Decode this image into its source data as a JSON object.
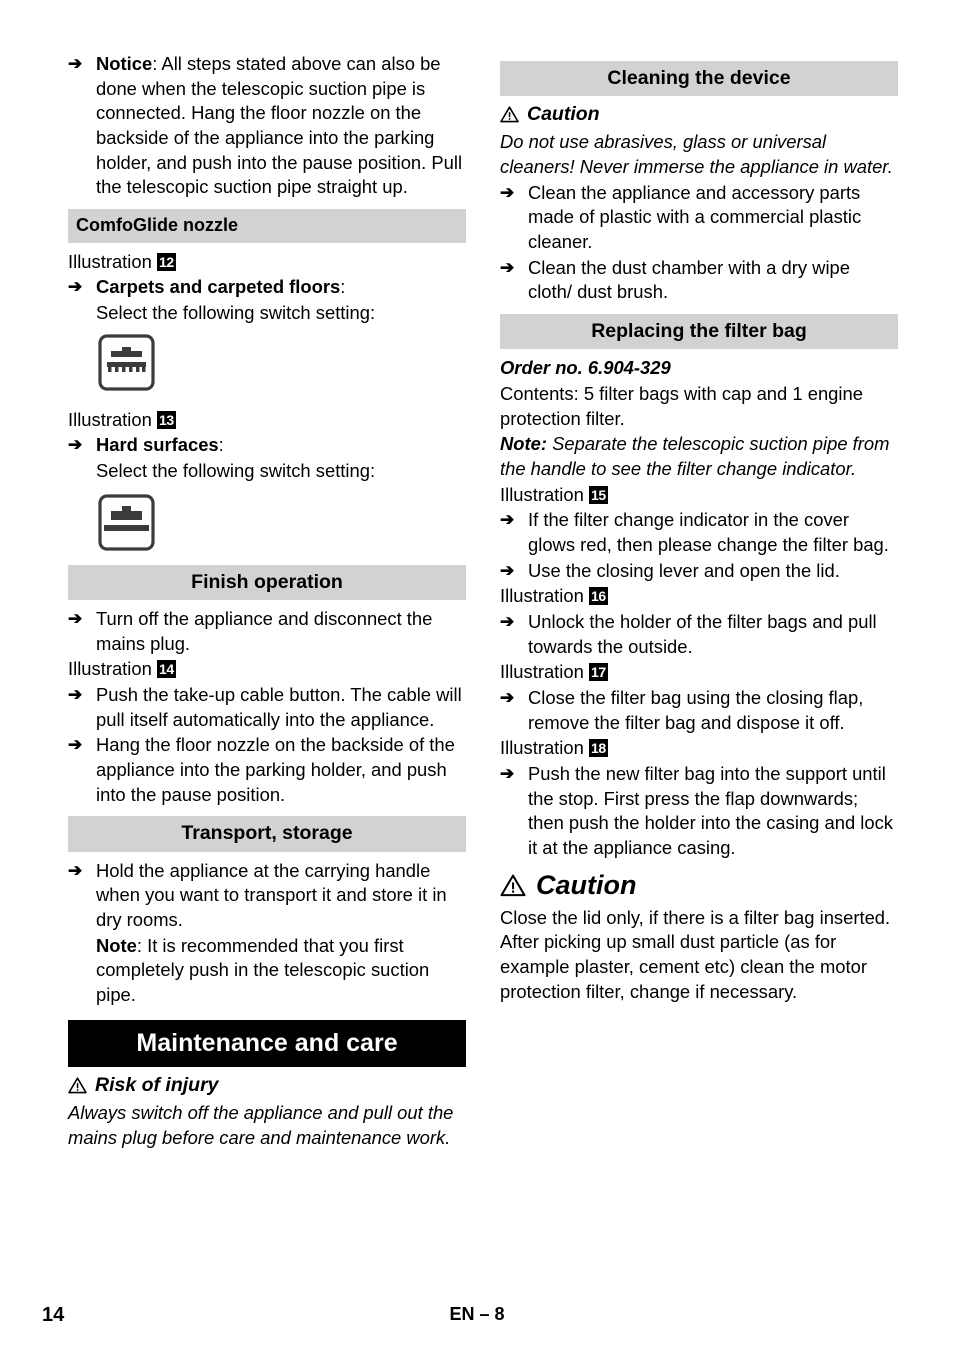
{
  "page": {
    "number": "14",
    "language_marker": "EN – 8",
    "colors": {
      "header_grey": "#d2d2d2",
      "header_black": "#000000",
      "text": "#000000",
      "page_background": "#ffffff"
    }
  },
  "left_column": {
    "notice_bullet": {
      "lead": "Notice",
      "text": ": All steps stated above can also be done when the telescopic suction pipe is connected. Hang the floor nozzle on the backside of the appliance into the parking holder, and push into the pause position. Pull the telescopic suction pipe straight up."
    },
    "comfoglide": {
      "heading": "ComfoGlide nozzle",
      "illustration_12_label": "Illustration",
      "illustration_12_number": "12",
      "carpets_lead": "Carpets and carpeted floors",
      "carpets_colon": ":",
      "carpets_instruction": "Select the following switch setting:",
      "carpet_icon_name": "carpet-switch-setting-icon",
      "illustration_13_label": "Illustration",
      "illustration_13_number": "13",
      "hard_lead": "Hard surfaces",
      "hard_colon": ":",
      "hard_instruction": "Select the following switch setting:",
      "hard_icon_name": "hard-surface-switch-setting-icon"
    },
    "finish_operation": {
      "heading": "Finish operation",
      "bullet_1": "Turn off the appliance and disconnect the mains plug.",
      "illustration_14_label": "Illustration",
      "illustration_14_number": "14",
      "bullet_2": "Push the take-up cable button. The cable will pull itself automatically into the appliance.",
      "bullet_3": "Hang the floor nozzle on the backside of the appliance into the parking holder, and push into the pause position."
    },
    "transport_storage": {
      "heading": "Transport, storage",
      "bullet_1": "Hold the appliance at the carrying handle when you want to transport it and store it in dry rooms.",
      "note_lead": "Note",
      "note_text": ": It is recommended that you first completely push in the telescopic suction pipe."
    },
    "maintenance": {
      "heading": "Maintenance and care",
      "risk_title": "Risk of injury",
      "risk_body": "Always switch off the appliance and pull out the mains plug before care and maintenance work."
    }
  },
  "right_column": {
    "cleaning": {
      "heading": "Cleaning the device",
      "caution_title": "Caution",
      "caution_body": "Do not use abrasives, glass or universal cleaners! Never immerse the appliance in water.",
      "bullet_1": "Clean the appliance and accessory parts made of plastic with a commercial plastic cleaner.",
      "bullet_2": "Clean the dust chamber with a dry wipe cloth/ dust brush."
    },
    "filter_bag": {
      "heading": "Replacing the filter bag",
      "order_no": "Order no. 6.904-329",
      "contents": "Contents: 5 filter bags with cap and 1 engine protection filter.",
      "note_lead": "Note:",
      "note_text": " Separate the telescopic suction pipe from the handle to see the filter change indicator.",
      "illustration_15_label": "Illustration",
      "illustration_15_number": "15",
      "bullet_1": "If the filter change indicator in the cover glows red, then please change the filter bag.",
      "bullet_2": "Use the closing lever and open the lid.",
      "illustration_16_label": "Illustration",
      "illustration_16_number": "16",
      "bullet_3": "Unlock the holder of the filter bags and pull towards the outside.",
      "illustration_17_label": "Illustration",
      "illustration_17_number": "17",
      "bullet_4": "Close the filter bag using the closing flap, remove the filter bag and dispose it off.",
      "illustration_18_label": "Illustration",
      "illustration_18_number": "18",
      "bullet_5": "Push the new filter bag into the support until the stop. First press the flap downwards; then push the holder into the casing and lock it at the appliance casing."
    },
    "final_caution": {
      "title": "Caution",
      "body": "Close the lid only, if there is a filter bag inserted. After picking up small dust particle (as for example plaster, cement etc) clean the motor protection filter, change if necessary."
    }
  },
  "icons": {
    "arrow_bullet": "➔",
    "warning_triangle": "warning-triangle-icon"
  }
}
